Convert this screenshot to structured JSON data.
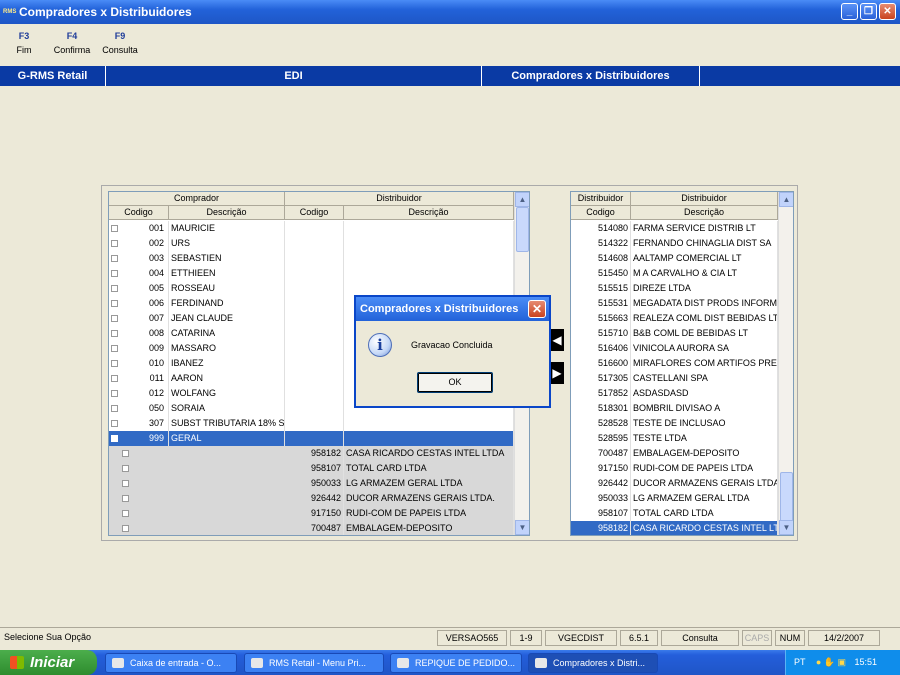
{
  "window": {
    "title": "Compradores x Distribuidores",
    "icon_text": "RMS"
  },
  "fkeys": [
    {
      "key": "F3",
      "label": "Fim"
    },
    {
      "key": "F4",
      "label": "Confirma"
    },
    {
      "key": "F9",
      "label": "Consulta"
    }
  ],
  "nav": {
    "app": "G-RMS Retail",
    "module": "EDI",
    "screen": "Compradores x Distribuidores"
  },
  "left_grid": {
    "header_groups": [
      "Comprador",
      "Distribuidor"
    ],
    "columns": [
      "Codigo",
      "Descrição",
      "Codigo",
      "Descrição"
    ],
    "rows": [
      {
        "cod": "001",
        "desc": "MAURICIE"
      },
      {
        "cod": "002",
        "desc": "URS"
      },
      {
        "cod": "003",
        "desc": "SEBASTIEN"
      },
      {
        "cod": "004",
        "desc": "ETTHIEEN"
      },
      {
        "cod": "005",
        "desc": "ROSSEAU"
      },
      {
        "cod": "006",
        "desc": "FERDINAND"
      },
      {
        "cod": "007",
        "desc": "JEAN CLAUDE"
      },
      {
        "cod": "008",
        "desc": "CATARINA"
      },
      {
        "cod": "009",
        "desc": "MASSARO"
      },
      {
        "cod": "010",
        "desc": "IBANEZ"
      },
      {
        "cod": "011",
        "desc": "AARON"
      },
      {
        "cod": "012",
        "desc": "WOLFANG"
      },
      {
        "cod": "050",
        "desc": "SORAIA"
      },
      {
        "cod": "307",
        "desc": "SUBST TRIBUTARIA 18% S"
      },
      {
        "cod": "999",
        "desc": "GERAL"
      }
    ],
    "children": [
      {
        "cod": "958182",
        "desc": "CASA RICARDO CESTAS INTEL LTDA"
      },
      {
        "cod": "958107",
        "desc": "TOTAL CARD LTDA"
      },
      {
        "cod": "950033",
        "desc": "LG ARMAZEM GERAL LTDA"
      },
      {
        "cod": "926442",
        "desc": "DUCOR ARMAZENS GERAIS LTDA."
      },
      {
        "cod": "917150",
        "desc": "RUDI-COM DE PAPEIS LTDA"
      },
      {
        "cod": "700487",
        "desc": "EMBALAGEM-DEPOSITO"
      }
    ]
  },
  "right_grid": {
    "header_groups": [
      "Distribuidor",
      "Distribuidor"
    ],
    "columns": [
      "Codigo",
      "Descrição"
    ],
    "rows": [
      {
        "cod": "514080",
        "desc": "FARMA SERVICE DISTRIB LT"
      },
      {
        "cod": "514322",
        "desc": "FERNANDO CHINAGLIA DIST SA"
      },
      {
        "cod": "514608",
        "desc": "AALTAMP COMERCIAL LT"
      },
      {
        "cod": "515450",
        "desc": "M A CARVALHO & CIA LT"
      },
      {
        "cod": "515515",
        "desc": "DIREZE LTDA"
      },
      {
        "cod": "515531",
        "desc": "MEGADATA DIST PRODS INFORM"
      },
      {
        "cod": "515663",
        "desc": "REALEZA COML DIST BEBIDAS LT"
      },
      {
        "cod": "515710",
        "desc": "B&B COML DE BEBIDAS LT"
      },
      {
        "cod": "516406",
        "desc": "VINICOLA AURORA SA"
      },
      {
        "cod": "516600",
        "desc": "MIRAFLORES COM ARTIFOS PRES"
      },
      {
        "cod": "517305",
        "desc": "CASTELLANI SPA"
      },
      {
        "cod": "517852",
        "desc": "ASDASDASD"
      },
      {
        "cod": "518301",
        "desc": "BOMBRIL DIVISAO A"
      },
      {
        "cod": "528528",
        "desc": "TESTE DE INCLUSAO"
      },
      {
        "cod": "528595",
        "desc": "TESTE LTDA"
      },
      {
        "cod": "700487",
        "desc": "EMBALAGEM-DEPOSITO"
      },
      {
        "cod": "917150",
        "desc": "RUDI-COM DE PAPEIS LTDA"
      },
      {
        "cod": "926442",
        "desc": "DUCOR ARMAZENS GERAIS LTDA"
      },
      {
        "cod": "950033",
        "desc": "LG ARMAZEM GERAL LTDA"
      },
      {
        "cod": "958107",
        "desc": "TOTAL CARD LTDA"
      },
      {
        "cod": "958182",
        "desc": "CASA RICARDO CESTAS INTEL LT"
      }
    ]
  },
  "dialog": {
    "title": "Compradores x Distribuidores",
    "message": "Gravacao Concluida",
    "ok": "OK",
    "icon": "info-icon"
  },
  "status": {
    "message": "Selecione Sua Opção",
    "version": "VERSAO565",
    "page": "1-9",
    "program": "VGECDIST",
    "release": "6.5.1",
    "mode": "Consulta",
    "caps": "CAPS",
    "num": "NUM",
    "date": "14/2/2007"
  },
  "taskbar": {
    "start": "Iniciar",
    "items": [
      "Caixa de entrada - O...",
      "RMS Retail - Menu Pri...",
      "REPIQUE DE PEDIDO...",
      "Compradores x Distri..."
    ],
    "lang": "PT",
    "time": "15:51"
  }
}
